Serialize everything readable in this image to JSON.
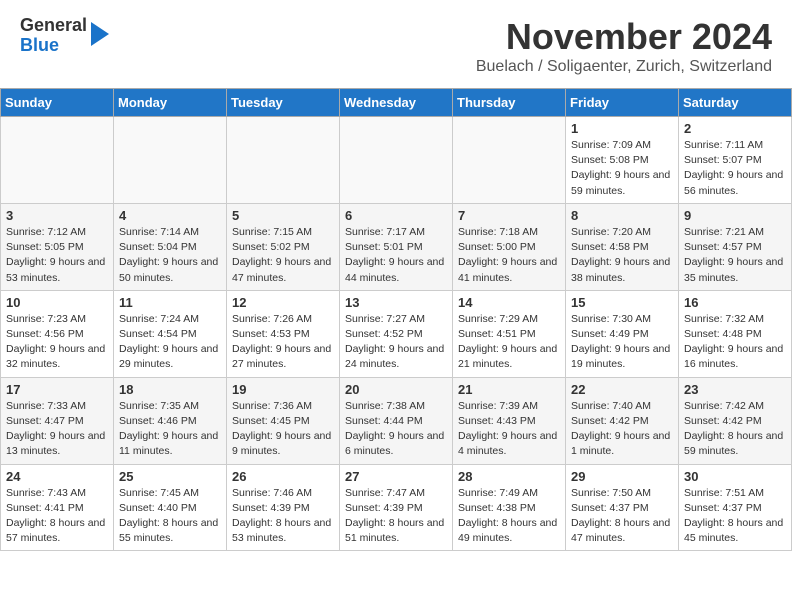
{
  "logo": {
    "general": "General",
    "blue": "Blue"
  },
  "title": "November 2024",
  "location": "Buelach / Soligaenter, Zurich, Switzerland",
  "headers": [
    "Sunday",
    "Monday",
    "Tuesday",
    "Wednesday",
    "Thursday",
    "Friday",
    "Saturday"
  ],
  "weeks": [
    [
      {
        "day": "",
        "info": ""
      },
      {
        "day": "",
        "info": ""
      },
      {
        "day": "",
        "info": ""
      },
      {
        "day": "",
        "info": ""
      },
      {
        "day": "",
        "info": ""
      },
      {
        "day": "1",
        "info": "Sunrise: 7:09 AM\nSunset: 5:08 PM\nDaylight: 9 hours and 59 minutes."
      },
      {
        "day": "2",
        "info": "Sunrise: 7:11 AM\nSunset: 5:07 PM\nDaylight: 9 hours and 56 minutes."
      }
    ],
    [
      {
        "day": "3",
        "info": "Sunrise: 7:12 AM\nSunset: 5:05 PM\nDaylight: 9 hours and 53 minutes."
      },
      {
        "day": "4",
        "info": "Sunrise: 7:14 AM\nSunset: 5:04 PM\nDaylight: 9 hours and 50 minutes."
      },
      {
        "day": "5",
        "info": "Sunrise: 7:15 AM\nSunset: 5:02 PM\nDaylight: 9 hours and 47 minutes."
      },
      {
        "day": "6",
        "info": "Sunrise: 7:17 AM\nSunset: 5:01 PM\nDaylight: 9 hours and 44 minutes."
      },
      {
        "day": "7",
        "info": "Sunrise: 7:18 AM\nSunset: 5:00 PM\nDaylight: 9 hours and 41 minutes."
      },
      {
        "day": "8",
        "info": "Sunrise: 7:20 AM\nSunset: 4:58 PM\nDaylight: 9 hours and 38 minutes."
      },
      {
        "day": "9",
        "info": "Sunrise: 7:21 AM\nSunset: 4:57 PM\nDaylight: 9 hours and 35 minutes."
      }
    ],
    [
      {
        "day": "10",
        "info": "Sunrise: 7:23 AM\nSunset: 4:56 PM\nDaylight: 9 hours and 32 minutes."
      },
      {
        "day": "11",
        "info": "Sunrise: 7:24 AM\nSunset: 4:54 PM\nDaylight: 9 hours and 29 minutes."
      },
      {
        "day": "12",
        "info": "Sunrise: 7:26 AM\nSunset: 4:53 PM\nDaylight: 9 hours and 27 minutes."
      },
      {
        "day": "13",
        "info": "Sunrise: 7:27 AM\nSunset: 4:52 PM\nDaylight: 9 hours and 24 minutes."
      },
      {
        "day": "14",
        "info": "Sunrise: 7:29 AM\nSunset: 4:51 PM\nDaylight: 9 hours and 21 minutes."
      },
      {
        "day": "15",
        "info": "Sunrise: 7:30 AM\nSunset: 4:49 PM\nDaylight: 9 hours and 19 minutes."
      },
      {
        "day": "16",
        "info": "Sunrise: 7:32 AM\nSunset: 4:48 PM\nDaylight: 9 hours and 16 minutes."
      }
    ],
    [
      {
        "day": "17",
        "info": "Sunrise: 7:33 AM\nSunset: 4:47 PM\nDaylight: 9 hours and 13 minutes."
      },
      {
        "day": "18",
        "info": "Sunrise: 7:35 AM\nSunset: 4:46 PM\nDaylight: 9 hours and 11 minutes."
      },
      {
        "day": "19",
        "info": "Sunrise: 7:36 AM\nSunset: 4:45 PM\nDaylight: 9 hours and 9 minutes."
      },
      {
        "day": "20",
        "info": "Sunrise: 7:38 AM\nSunset: 4:44 PM\nDaylight: 9 hours and 6 minutes."
      },
      {
        "day": "21",
        "info": "Sunrise: 7:39 AM\nSunset: 4:43 PM\nDaylight: 9 hours and 4 minutes."
      },
      {
        "day": "22",
        "info": "Sunrise: 7:40 AM\nSunset: 4:42 PM\nDaylight: 9 hours and 1 minute."
      },
      {
        "day": "23",
        "info": "Sunrise: 7:42 AM\nSunset: 4:42 PM\nDaylight: 8 hours and 59 minutes."
      }
    ],
    [
      {
        "day": "24",
        "info": "Sunrise: 7:43 AM\nSunset: 4:41 PM\nDaylight: 8 hours and 57 minutes."
      },
      {
        "day": "25",
        "info": "Sunrise: 7:45 AM\nSunset: 4:40 PM\nDaylight: 8 hours and 55 minutes."
      },
      {
        "day": "26",
        "info": "Sunrise: 7:46 AM\nSunset: 4:39 PM\nDaylight: 8 hours and 53 minutes."
      },
      {
        "day": "27",
        "info": "Sunrise: 7:47 AM\nSunset: 4:39 PM\nDaylight: 8 hours and 51 minutes."
      },
      {
        "day": "28",
        "info": "Sunrise: 7:49 AM\nSunset: 4:38 PM\nDaylight: 8 hours and 49 minutes."
      },
      {
        "day": "29",
        "info": "Sunrise: 7:50 AM\nSunset: 4:37 PM\nDaylight: 8 hours and 47 minutes."
      },
      {
        "day": "30",
        "info": "Sunrise: 7:51 AM\nSunset: 4:37 PM\nDaylight: 8 hours and 45 minutes."
      }
    ]
  ]
}
